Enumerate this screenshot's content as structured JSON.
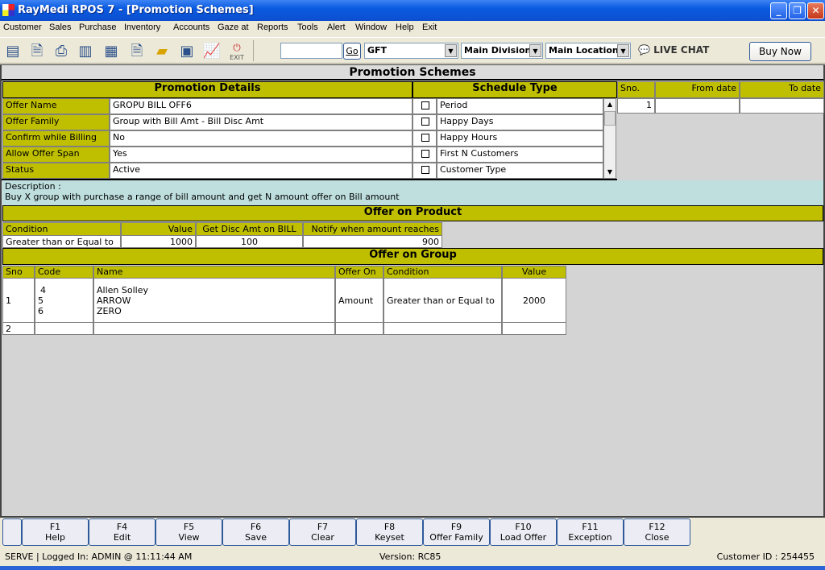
{
  "window": {
    "title": "RayMedi RPOS 7 - [Promotion Schemes]"
  },
  "menu": [
    "Customer",
    "Sales",
    "Purchase",
    "Inventory",
    "Accounts",
    "Gaze at",
    "Reports",
    "Tools",
    "Alert",
    "Window",
    "Help",
    "Exit"
  ],
  "toolbar": {
    "exit_label": "EXIT",
    "search_value": "",
    "go_label": "Go",
    "dropdown1": "GFT",
    "dropdown2": "Main Division",
    "dropdown3": "Main Location",
    "live_chat": "LIVE CHAT",
    "buy_now": "Buy Now"
  },
  "page_title": "Promotion Schemes",
  "promotion_details": {
    "title": "Promotion Details",
    "rows": [
      {
        "label": "Offer Name",
        "value": "GROPU BILL OFF6"
      },
      {
        "label": "Offer Family",
        "value": "Group with Bill Amt - Bill Disc Amt"
      },
      {
        "label": "Confirm while Billing",
        "value": "No"
      },
      {
        "label": "Allow Offer Span",
        "value": "Yes"
      },
      {
        "label": "Status",
        "value": "Active"
      }
    ]
  },
  "schedule_type": {
    "title": "Schedule Type",
    "options": [
      "Period",
      "Happy Days",
      "Happy Hours",
      "First N Customers",
      "Customer Type"
    ]
  },
  "schedule_grid": {
    "headers": [
      "Sno.",
      "From date",
      "To date"
    ],
    "rows": [
      [
        "1",
        "",
        ""
      ]
    ]
  },
  "description": {
    "label": "Description :",
    "text": "Buy X group with purchase a range of bill amount and get N amount offer on Bill amount"
  },
  "offer_on_product": {
    "title": "Offer on Product",
    "headers": [
      "Condition",
      "Value",
      "Get Disc Amt on BILL",
      "Notify when amount reaches"
    ],
    "row": [
      "Greater than or Equal to",
      "1000",
      "100",
      "900"
    ]
  },
  "offer_on_group": {
    "title": "Offer on Group",
    "headers": [
      "Sno",
      "Code",
      "Name",
      "Offer On",
      "Condition",
      "Value"
    ],
    "rows": [
      {
        "sno": "1",
        "codes": [
          "4",
          "5",
          "6"
        ],
        "names": [
          "Allen Solley",
          "ARROW",
          "ZERO"
        ],
        "offer_on": "Amount",
        "condition": "Greater than or Equal to",
        "value": "2000"
      },
      {
        "sno": "2",
        "codes": [],
        "names": [],
        "offer_on": "",
        "condition": "",
        "value": ""
      }
    ]
  },
  "fkeys": [
    {
      "key": "F1",
      "label": "Help"
    },
    {
      "key": "F4",
      "label": "Edit"
    },
    {
      "key": "F5",
      "label": "View"
    },
    {
      "key": "F6",
      "label": "Save"
    },
    {
      "key": "F7",
      "label": "Clear"
    },
    {
      "key": "F8",
      "label": "Keyset"
    },
    {
      "key": "F9",
      "label": "Offer Family"
    },
    {
      "key": "F10",
      "label": "Load Offer"
    },
    {
      "key": "F11",
      "label": "Exception"
    },
    {
      "key": "F12",
      "label": "Close"
    }
  ],
  "status": {
    "left": "SERVE |  Logged In: ADMIN  @ 11:11:44 AM",
    "version": "Version: RC85",
    "customer_id": "Customer ID : 254455"
  }
}
